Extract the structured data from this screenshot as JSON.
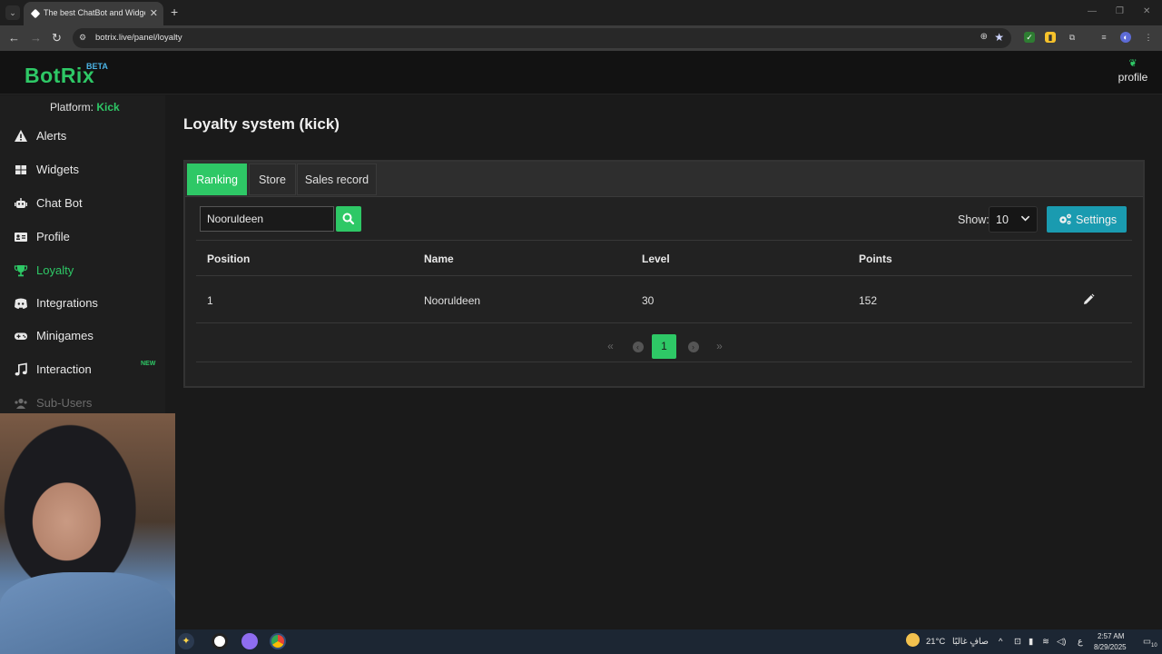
{
  "browser": {
    "tab_title": "The best ChatBot and Widgets",
    "url": "botrix.live/panel/loyalty"
  },
  "app": {
    "logo": "BotRix",
    "beta": "BETA",
    "profile_label": "profile",
    "platform_label": "Platform:",
    "platform_value": "Kick"
  },
  "sidebar": {
    "items": [
      {
        "label": "Alerts",
        "icon": "warning-icon"
      },
      {
        "label": "Widgets",
        "icon": "grid-icon"
      },
      {
        "label": "Chat Bot",
        "icon": "robot-icon"
      },
      {
        "label": "Profile",
        "icon": "id-card-icon"
      },
      {
        "label": "Loyalty",
        "icon": "trophy-icon"
      },
      {
        "label": "Integrations",
        "icon": "discord-icon"
      },
      {
        "label": "Minigames",
        "icon": "gamepad-icon"
      },
      {
        "label": "Interaction",
        "icon": "music-icon"
      },
      {
        "label": "Sub-Users",
        "icon": "users-icon"
      }
    ],
    "new_badge": "NEW"
  },
  "main": {
    "title": "Loyalty system (kick)",
    "tabs": [
      "Ranking",
      "Store",
      "Sales record"
    ],
    "search_value": "Nooruldeen",
    "show_label": "Show:",
    "show_value": "10",
    "settings_label": "Settings",
    "table": {
      "headers": [
        "Position",
        "Name",
        "Level",
        "Points"
      ],
      "rows": [
        {
          "position": "1",
          "name": "Nooruldeen",
          "level": "30",
          "points": "152"
        }
      ]
    },
    "pagination": {
      "current": "1"
    }
  },
  "taskbar": {
    "weather_temp": "21°C",
    "weather_text": "صافٍ غالبًا",
    "lang": "ع",
    "time": "2:57 AM",
    "date": "8/29/2025",
    "notif_count": "10"
  },
  "colors": {
    "accent": "#2ec866",
    "settings": "#1a9bb0",
    "background": "#1a1a1a"
  }
}
